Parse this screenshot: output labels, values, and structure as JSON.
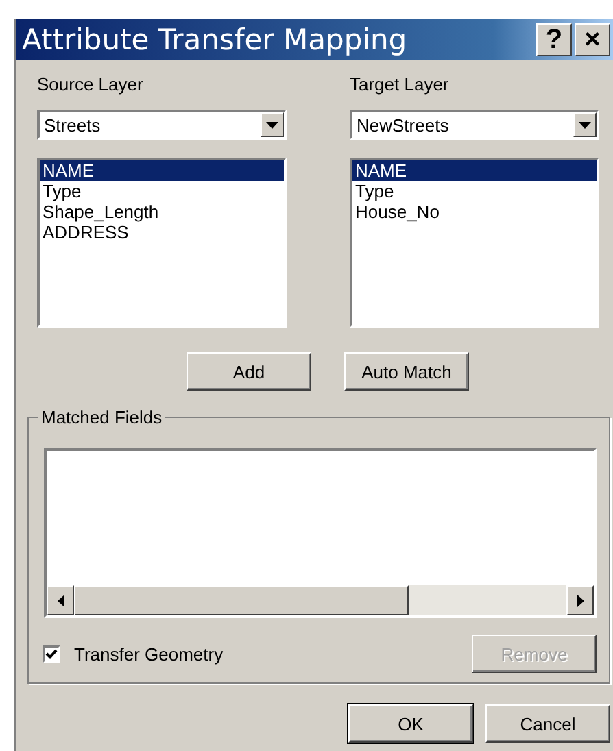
{
  "window": {
    "title": "Attribute Transfer Mapping",
    "help": "?",
    "close": "×"
  },
  "layers": [
    {
      "label": "Source Layer",
      "value": "Streets",
      "fields": [
        {
          "text": "NAME",
          "selected": true
        },
        {
          "text": "Type",
          "selected": false
        },
        {
          "text": "Shape_Length",
          "selected": false
        },
        {
          "text": "ADDRESS",
          "selected": false
        }
      ]
    },
    {
      "label": "Target Layer",
      "value": "NewStreets",
      "fields": [
        {
          "text": "NAME",
          "selected": true
        },
        {
          "text": "Type",
          "selected": false
        },
        {
          "text": "House_No",
          "selected": false
        }
      ]
    }
  ],
  "actions": [
    {
      "label": "Add",
      "disabled": false
    },
    {
      "label": "Auto Match",
      "disabled": false
    }
  ],
  "matched_fields": {
    "title": "Matched Fields",
    "transfer_geometry": {
      "label": "Transfer Geometry",
      "checked": true
    },
    "remove": {
      "label": "Remove",
      "disabled": true
    }
  },
  "buttons": [
    {
      "label": "OK",
      "default": true
    },
    {
      "label": "Cancel",
      "default": false
    }
  ]
}
